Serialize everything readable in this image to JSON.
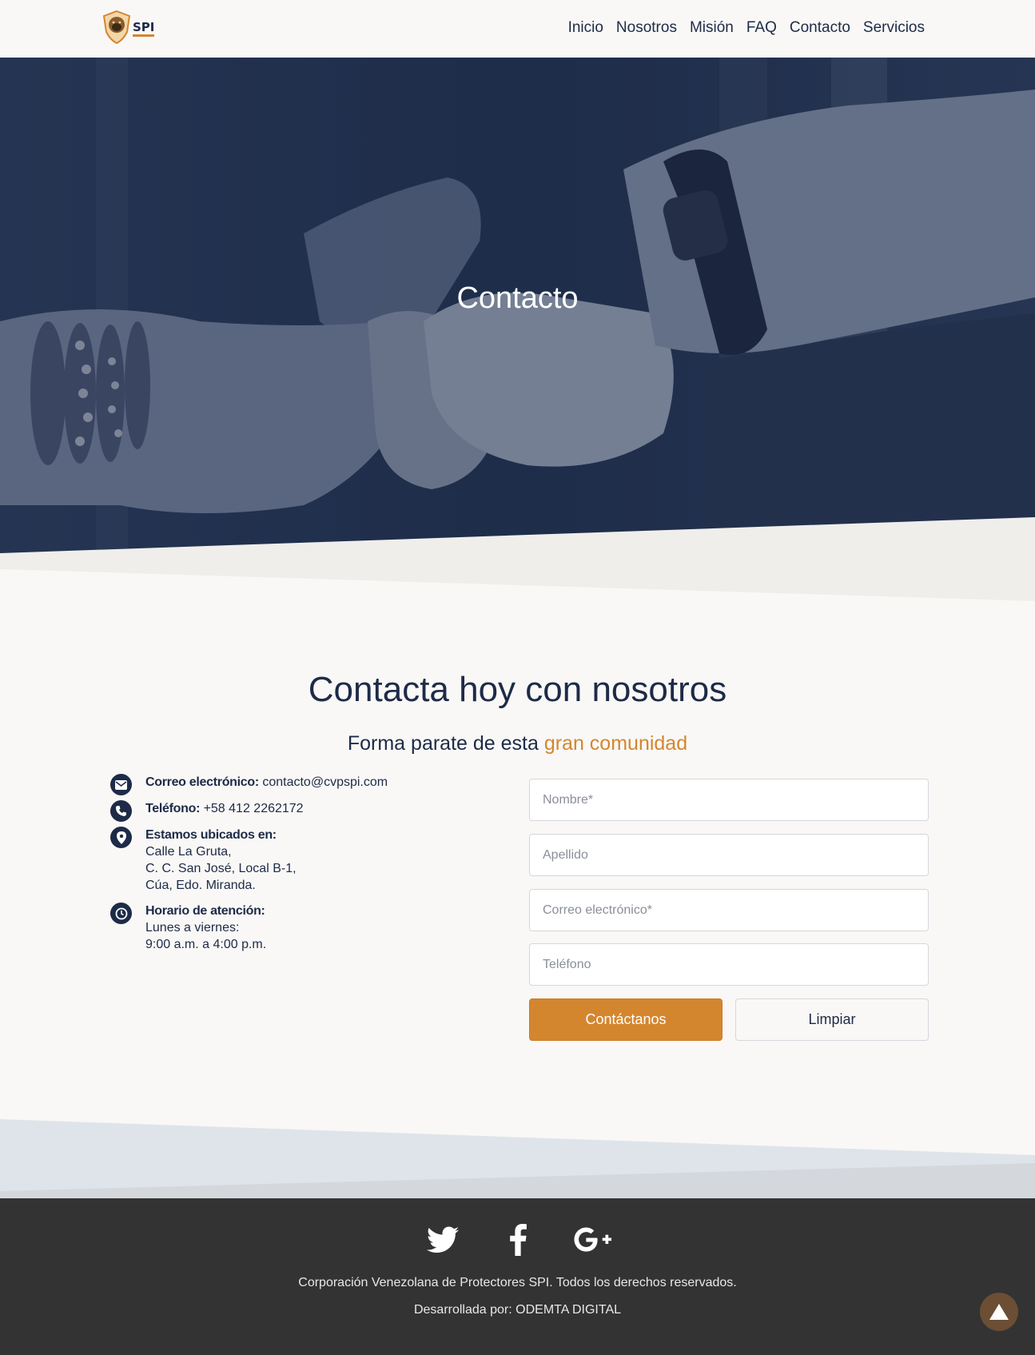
{
  "brand": {
    "logo_text": "SPI"
  },
  "nav": {
    "items": [
      "Inicio",
      "Nosotros",
      "Misión",
      "FAQ",
      "Contacto",
      "Servicios"
    ]
  },
  "hero": {
    "title": "Contacto"
  },
  "section": {
    "title": "Contacta hoy con nosotros",
    "subtitle_prefix": "Forma parate de esta ",
    "subtitle_accent": "gran comunidad"
  },
  "info": {
    "email_label": "Correo electrónico:",
    "email_value": "contacto@cvpspi.com",
    "phone_label": "Teléfono:",
    "phone_value": "+58 412 2262172",
    "location_label": "Estamos ubicados en:",
    "location_line1": "Calle La Gruta,",
    "location_line2": "C. C. San José, Local B-1,",
    "location_line3": "Cúa, Edo. Miranda.",
    "hours_label": "Horario de atención:",
    "hours_line1": "Lunes a viernes:",
    "hours_line2": "9:00 a.m. a 4:00 p.m."
  },
  "form": {
    "name_placeholder": "Nombre*",
    "lastname_placeholder": "Apellido",
    "email_placeholder": "Correo electrónico*",
    "phone_placeholder": "Teléfono",
    "submit_label": "Contáctanos",
    "clear_label": "Limpiar"
  },
  "footer": {
    "social": [
      "twitter-icon",
      "facebook-icon",
      "google-plus-icon"
    ],
    "copyright": "Corporación Venezolana de Protectores SPI. Todos los derechos reservados.",
    "developer": "Desarrollada por: ODEMTA DIGITAL"
  },
  "colors": {
    "navy": "#1d2b48",
    "accent": "#d4862f",
    "footer": "#333333",
    "background": "#f9f8f6"
  }
}
